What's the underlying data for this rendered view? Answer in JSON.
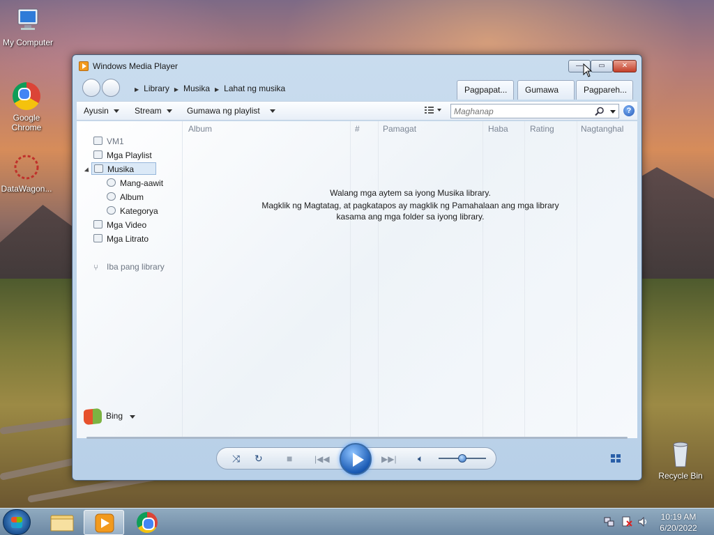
{
  "desktop": {
    "icons": [
      {
        "label": "My Computer",
        "icon": "computer-icon"
      },
      {
        "label": "Google Chrome",
        "icon": "chrome-icon"
      },
      {
        "label": "DataWagon...",
        "icon": "datawagon-icon"
      },
      {
        "label": "Recycle Bin",
        "icon": "recycle-bin-icon"
      }
    ]
  },
  "window": {
    "title": "Windows Media Player",
    "buttons": {
      "minimize": "—",
      "maximize": "▭",
      "close": "✕"
    }
  },
  "breadcrumb": [
    "Library",
    "Musika",
    "Lahat ng musika"
  ],
  "top_tabs": [
    "Pagpapat...",
    "Gumawa ...",
    "Pagpareh..."
  ],
  "toolbar": {
    "organize": "Ayusin",
    "stream": "Stream",
    "create_playlist": "Gumawa ng playlist",
    "search_placeholder": "Maghanap",
    "help": "?"
  },
  "nav_tree": {
    "vm": "VM1",
    "playlists": "Mga Playlist",
    "music": "Musika",
    "artist": "Mang-aawit",
    "album": "Album",
    "genre": "Kategorya",
    "videos": "Mga Video",
    "pictures": "Mga Litrato",
    "other_libraries": "Iba pang library"
  },
  "columns": [
    "Album",
    "#",
    "Pamagat",
    "Haba",
    "Rating",
    "Nagtanghal"
  ],
  "empty_message": {
    "line1": "Walang mga aytem sa iyong Musika library.",
    "line2": "Magklik ng Magtatag, at pagkatapos ay magklik ng Pamahalaan ang mga library",
    "line3": "kasama ang mga folder sa iyong library."
  },
  "bing": {
    "label": "Bing"
  },
  "player": {
    "volume_level": 0.5,
    "seek_position": 0
  },
  "taskbar": {
    "time": "10:19 AM",
    "date": "6/20/2022"
  },
  "colors": {
    "accent": "#2a5fa8",
    "title_bar": "#c9dcee",
    "close_button": "#c4402a"
  }
}
